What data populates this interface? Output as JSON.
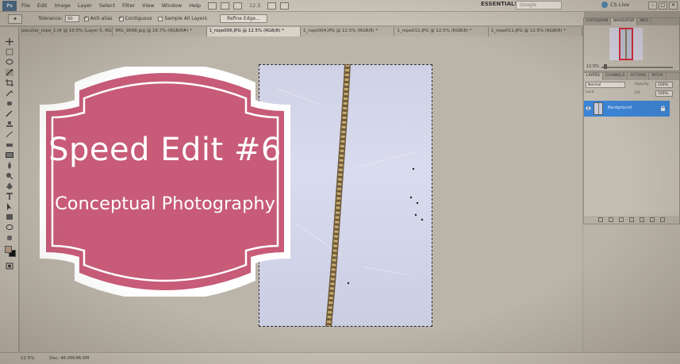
{
  "app": {
    "logo": "Ps",
    "menu": [
      "File",
      "Edit",
      "Image",
      "Layer",
      "Select",
      "Filter",
      "View",
      "Window",
      "Help"
    ],
    "zoom_readout": "12.5",
    "workspace": "ESSENTIALS",
    "search_placeholder": "Google",
    "cs_live": "CS Live",
    "window_buttons": [
      "–",
      "□",
      "✕"
    ]
  },
  "options": {
    "tolerance_label": "Tolerance:",
    "tolerance_value": "30",
    "anti_alias": "Anti-alias",
    "contiguous": "Contiguous",
    "sample_all_layers": "Sample All Layers",
    "refine_edge": "Refine Edge..."
  },
  "tabs": [
    "peculiar_rope_1.tif @ 10.5% (Layer 5, RGB/8#) *",
    "IMG_9098.jpg @ 16.7% (RGB/8#) *",
    "1_rope006.JPG @ 12.5% (RGB/8) *",
    "1_rope004.JPG @ 12.5% (RGB/8) *",
    "1_rope012.JPG @ 12.5% (RGB/8) *",
    "1_rope011.JPG @ 12.5% (RGB/8) *"
  ],
  "navigator": {
    "tabs": [
      "HISTOGRAM",
      "NAVIGATOR",
      "INFO"
    ],
    "zoom": "12.5%"
  },
  "layers": {
    "tabs": [
      "LAYERS",
      "CHANNELS",
      "ACTIONS",
      "PATHS"
    ],
    "blend_mode": "Normal",
    "opacity_label": "Opacity:",
    "opacity_value": "100%",
    "lock_label": "Lock:",
    "fill_label": "Fill:",
    "fill_value": "100%",
    "layer_name": "Background"
  },
  "status": {
    "zoom": "12.5%",
    "doc": "Doc: 46.0M/46.0M"
  },
  "badge": {
    "title": "Speed Edit #6",
    "subtitle": "Conceptual Photography",
    "fill_color": "#c24d6c",
    "border_color": "#ffffff"
  }
}
